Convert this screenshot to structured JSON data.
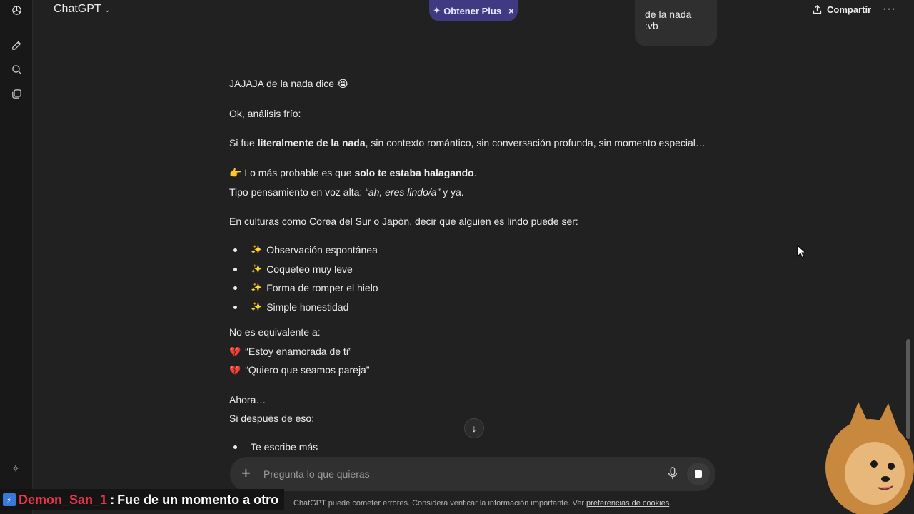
{
  "topbar": {
    "model_name": "ChatGPT",
    "upgrade_label": "Obtener Plus",
    "upgrade_close": "×",
    "share_label": "Compartir",
    "more_label": "···"
  },
  "user_message": "de la nada :vb",
  "assistant": {
    "line1": "JAJAJA de la nada dice",
    "line1_emoji": "😭",
    "line2": "Ok, análisis frío:",
    "line3_pre": "Si fue ",
    "line3_bold": "literalmente de la nada",
    "line3_post": ", sin contexto romántico, sin conversación profunda, sin momento especial…",
    "line4_emoji": "👉",
    "line4_pre": " Lo más probable es que ",
    "line4_bold": "solo te estaba halagando",
    "line4_post": ".",
    "line5_pre": "Tipo pensamiento en voz alta: ",
    "line5_italic": "“ah, eres lindo/a”",
    "line5_post": " y ya.",
    "line6_pre": "En culturas como ",
    "line6_link1": "Corea del Sur",
    "line6_mid": " o ",
    "line6_link2": "Japón",
    "line6_post": ", decir que alguien es lindo puede ser:",
    "bullets": [
      "Observación espontánea",
      "Coqueteo muy leve",
      "Forma de romper el hielo",
      "Simple honestidad"
    ],
    "spark_glyph": "✨",
    "line7": "No es equivalente a:",
    "heart_glyph": "💔",
    "not_equiv": [
      "“Estoy enamorada de ti”",
      "“Quiero que seamos pareja”"
    ],
    "line8": "Ahora…",
    "line9": "Si después de eso:",
    "bullets2": [
      "Te escribe más"
    ]
  },
  "composer": {
    "placeholder": "Pregunta lo que quieras"
  },
  "disclaimer": {
    "text": "ChatGPT puede cometer errores. Considera verificar la información importante. Ver ",
    "link": "preferencias de cookies",
    "end": "."
  },
  "stream_overlay": {
    "username": "Demon_San_1",
    "separator": " : ",
    "message": "Fue de un momento a otro"
  },
  "icons": {
    "logo": "openai-logo-icon",
    "new_chat": "edit-icon",
    "search": "search-icon",
    "library": "library-icon",
    "sparkle": "sparkle-icon",
    "share": "share-icon",
    "mic": "mic-icon",
    "stop": "stop-icon",
    "scroll_down": "arrow-down-icon"
  },
  "colors": {
    "background": "#212121",
    "sidebar": "#181818",
    "accent_plus": "#3f3a82",
    "overlay_username": "#e8364a"
  }
}
